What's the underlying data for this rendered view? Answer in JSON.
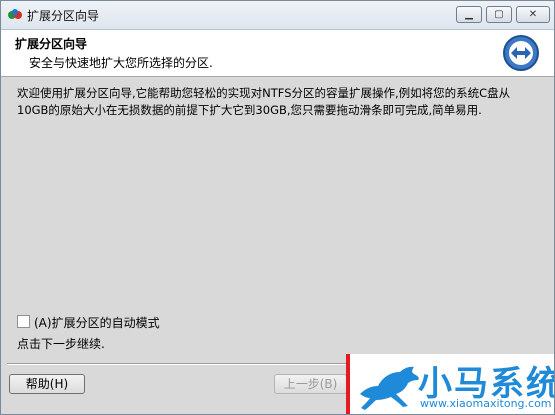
{
  "window": {
    "title": "扩展分区向导"
  },
  "titlebar_buttons": {
    "minimize": "▁",
    "maximize": "▢",
    "close": "✕"
  },
  "header": {
    "title": "扩展分区向导",
    "subtitle": "安全与快速地扩大您所选择的分区.",
    "icon": "resize-arrows-icon"
  },
  "body": {
    "description": "欢迎使用扩展分区向导,它能帮助您轻松的实现对NTFS分区的容量扩展操作,例如将您的系统C盘从10GB的原始大小在无损数据的前提下扩大它到30GB,您只需要拖动滑条即可完成,简单易用.",
    "auto_mode_label": "(A)扩展分区的自动模式",
    "auto_mode_checked": false,
    "continue_hint": "点击下一步继续."
  },
  "buttons": {
    "help": "帮助(H)",
    "back": "上一步(B)"
  },
  "watermark": {
    "brand": "小马系统",
    "url": "www.xiaomaxitong.com",
    "accent": "#1f8ad8",
    "bar_color": "#e31b23"
  }
}
